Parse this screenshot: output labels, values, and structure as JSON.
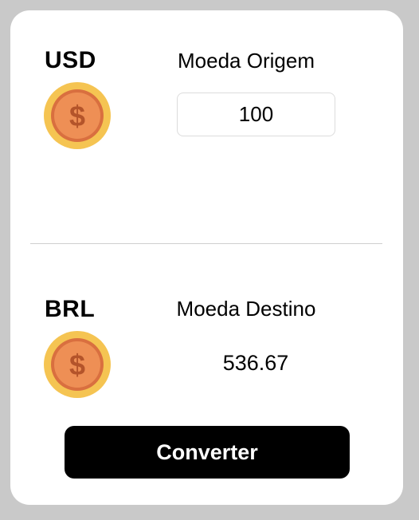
{
  "source": {
    "code": "USD",
    "label": "Moeda Origem",
    "amount": "100",
    "icon": "dollar-coin-icon"
  },
  "target": {
    "code": "BRL",
    "label": "Moeda Destino",
    "amount": "536.67",
    "icon": "dollar-coin-icon"
  },
  "actions": {
    "convert_label": "Converter"
  },
  "colors": {
    "coin_outer": "#f5c452",
    "coin_inner": "#ee8f55",
    "coin_symbol": "#b4542a",
    "button_bg": "#000000",
    "button_text": "#ffffff"
  }
}
